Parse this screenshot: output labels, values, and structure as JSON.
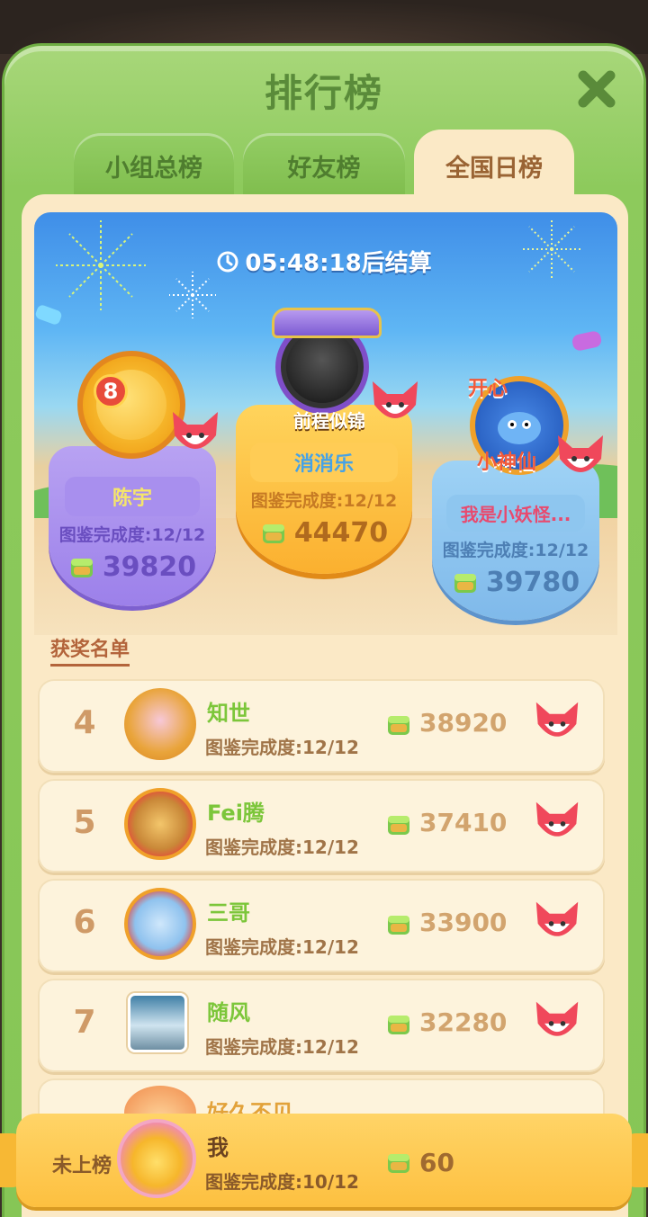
{
  "header": {
    "title": "排行榜"
  },
  "tabs": [
    {
      "label": "小组总榜",
      "active": false
    },
    {
      "label": "好友榜",
      "active": false
    },
    {
      "label": "全国日榜",
      "active": true
    }
  ],
  "timer": {
    "text": "05:48:18后结算"
  },
  "podium": {
    "second": {
      "rank_badge": "8",
      "name": "陈宇",
      "progress": "图鉴完成度:12/12",
      "score": "39820"
    },
    "first": {
      "frame_label": "前程似锦",
      "name": "消消乐",
      "progress": "图鉴完成度:12/12",
      "score": "44470"
    },
    "third": {
      "frame_label_top": "开心",
      "frame_label_bottom": "小神仙",
      "name": "我是小妖怪...",
      "progress": "图鉴完成度:12/12",
      "score": "39780"
    }
  },
  "section": {
    "title": "获奖名单"
  },
  "list": [
    {
      "rank": "4",
      "name": "知世",
      "progress": "图鉴完成度:12/12",
      "score": "38920",
      "name_color": "#7cc63a"
    },
    {
      "rank": "5",
      "name": "Fei腾",
      "progress": "图鉴完成度:12/12",
      "score": "37410",
      "name_color": "#7cc63a"
    },
    {
      "rank": "6",
      "name": "三哥",
      "progress": "图鉴完成度:12/12",
      "score": "33900",
      "name_color": "#7cc63a"
    },
    {
      "rank": "7",
      "name": "随风",
      "progress": "图鉴完成度:12/12",
      "score": "32280",
      "name_color": "#7cc63a"
    },
    {
      "rank": "",
      "name": "好久不见",
      "progress": "",
      "score": "",
      "name_color": "#e2a23a"
    }
  ],
  "self": {
    "label": "未上榜",
    "name": "我",
    "progress": "图鉴完成度:10/12",
    "score": "60"
  },
  "colors": {
    "panel_green": "#8dca5c",
    "content_cream": "#fbe9c6",
    "gold_bar": "#fdc040"
  }
}
